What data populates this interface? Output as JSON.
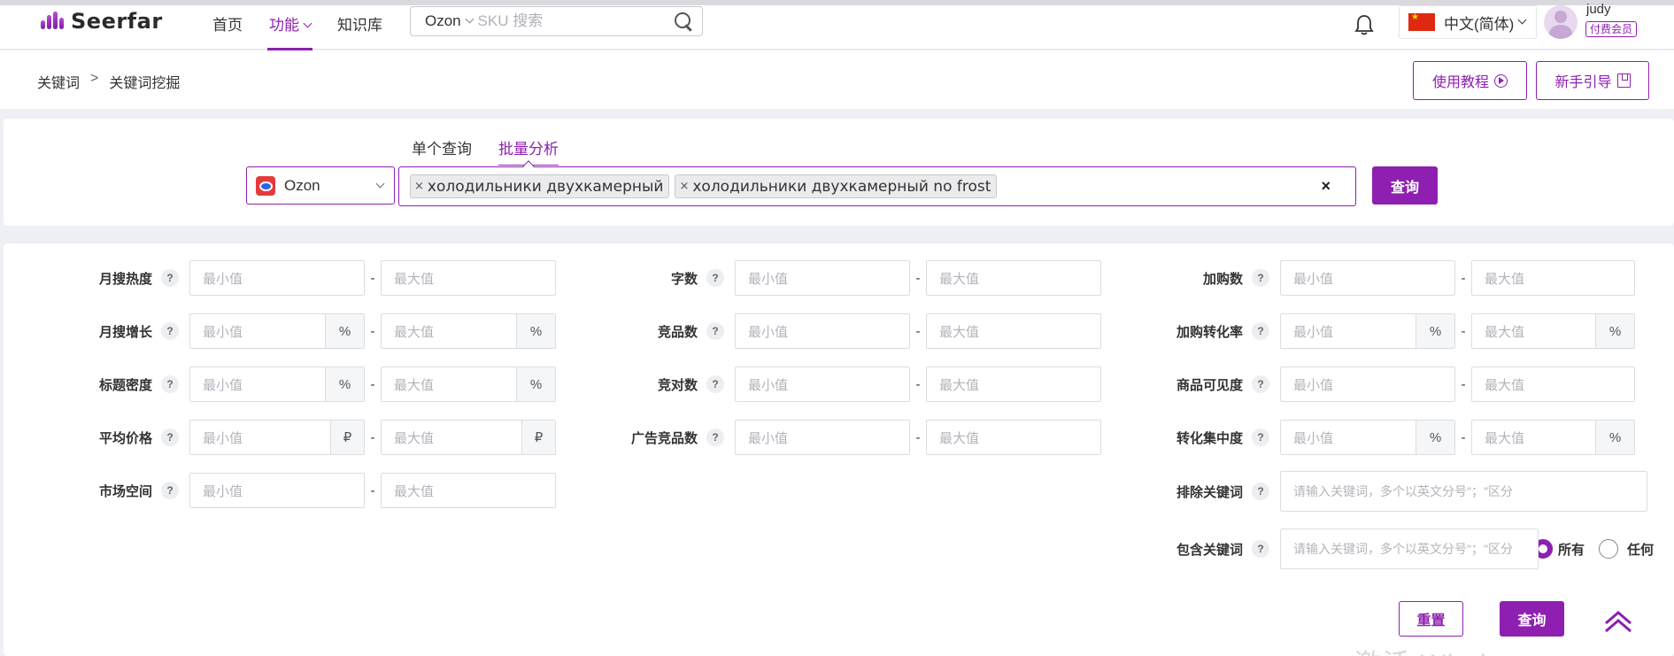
{
  "header": {
    "logo_text": "Seerfar",
    "nav": [
      {
        "label": "首页"
      },
      {
        "label": "功能"
      },
      {
        "label": "知识库"
      }
    ],
    "search": {
      "platform": "Ozon",
      "placeholder": "SKU 搜索"
    },
    "language": "中文(简体)",
    "user": {
      "name": "judy",
      "badge": "付费会员"
    }
  },
  "breadcrumb": {
    "items": [
      "关键词",
      "关键词挖掘"
    ],
    "separator": ">"
  },
  "top_buttons": {
    "tutorial": "使用教程",
    "guide": "新手引导"
  },
  "query": {
    "tabs": [
      "单个查询",
      "批量分析"
    ],
    "active_tab": "批量分析",
    "platform": "Ozon",
    "keywords": [
      "холодильники двухкамерный",
      "холодильники двухкамерный no frost"
    ],
    "tag_close": "×",
    "clear": "×",
    "submit": "查询"
  },
  "filters": {
    "min_placeholder": "最小值",
    "max_placeholder": "最大值",
    "help": "?",
    "col1": [
      {
        "label": "月搜热度",
        "unit": ""
      },
      {
        "label": "月搜增长",
        "unit": "%"
      },
      {
        "label": "标题密度",
        "unit": "%"
      },
      {
        "label": "平均价格",
        "unit": "₽"
      },
      {
        "label": "市场空间",
        "unit": ""
      }
    ],
    "col2": [
      {
        "label": "字数",
        "unit": ""
      },
      {
        "label": "竞品数",
        "unit": ""
      },
      {
        "label": "竞对数",
        "unit": ""
      },
      {
        "label": "广告竞品数",
        "unit": ""
      }
    ],
    "col3": [
      {
        "label": "加购数",
        "unit": ""
      },
      {
        "label": "加购转化率",
        "unit": "%"
      },
      {
        "label": "商品可见度",
        "unit": ""
      },
      {
        "label": "转化集中度",
        "unit": "%"
      }
    ],
    "exclude": {
      "label": "排除关键词",
      "placeholder": "请输入关键词，多个以英文分号\"；\"区分"
    },
    "include": {
      "label": "包含关键词",
      "placeholder": "请输入关键词，多个以英文分号\"；\"区分",
      "option_all": "所有",
      "option_any": "任何"
    },
    "reset": "重置",
    "submit": "查询"
  },
  "colors": {
    "accent": "#8e1fb0"
  },
  "watermark": "激活 Wind"
}
